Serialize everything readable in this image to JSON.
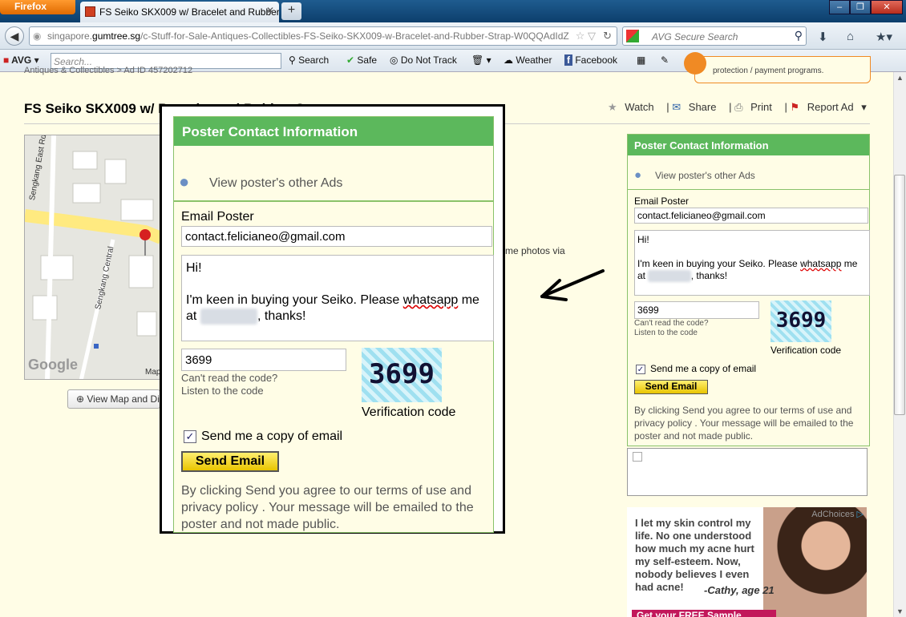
{
  "browser": {
    "app_button": "Firefox",
    "tab_title": "FS Seiko SKX009 w/ Bracelet and Rubber ...",
    "new_tab": "+",
    "url_host": "singapore.",
    "url_domain": "gumtree.sg",
    "url_path": "/c-Stuff-for-Sale-Antiques-Collectibles-FS-Seiko-SKX009-w-Bracelet-and-Rubber-Strap-W0QQAdIdZ",
    "search_placeholder": "AVG Secure Search"
  },
  "avg_toolbar": {
    "logo": "AVG",
    "search_placeholder": "Search...",
    "search_label": "Search",
    "safe": "Safe",
    "dnt": "Do Not Track",
    "weather": "Weather",
    "facebook": "Facebook"
  },
  "page": {
    "breadcrumb": "Antiques & Collectibles  >  Ad ID 457202712",
    "title": "FS Seiko SKX009 w/ Bracelet and Rubber Strap",
    "watch": "Watch",
    "share": "Share",
    "print": "Print",
    "report": "Report Ad",
    "photos_via": "me photos via",
    "view_map": "View Map and Directions",
    "protection": "protection / payment programs.",
    "map_roads": [
      "Sengkang East Rd",
      "Sengkang Central"
    ],
    "map_map": "Map",
    "map_google": "Google"
  },
  "contact": {
    "header": "Poster Contact Information",
    "other_ads": "View poster's other Ads",
    "email_label": "Email Poster",
    "email_value": "contact.felicianeo@gmail.com",
    "msg_line1": "Hi!",
    "msg_line2a": "I'm keen in buying your Seiko. Please ",
    "msg_whatsapp": "whatsapp",
    "msg_line2b": " me",
    "msg_line3a": "at ",
    "msg_blur": "87521089",
    "msg_line3b": ", thanks!",
    "code_value": "3699",
    "cant_read": "Can't read the code?",
    "listen": "Listen to the code",
    "captcha": "3699",
    "verification": "Verification code",
    "copy_label": "Send me a copy of email",
    "copy_check": "✓",
    "send": "Send Email",
    "terms": "By clicking Send you agree to our terms of use and privacy policy . Your message will be emailed to the poster and not made public."
  },
  "ad": {
    "choices": "AdChoices",
    "quote": "I let my skin control my life. No one understood how much my acne hurt my self-esteem. Now, nobody believes I even had acne!",
    "sig": "-Cathy, age 21",
    "cta": "Get your FREE Sample"
  },
  "icons": {
    "back": "back-arrow-icon",
    "person": "person-icon",
    "zoom": "magnifier-plus-icon"
  },
  "colors": {
    "header_green": "#5cb85c",
    "send_yellow": "#f2d600",
    "page_bg": "#fffde6"
  }
}
